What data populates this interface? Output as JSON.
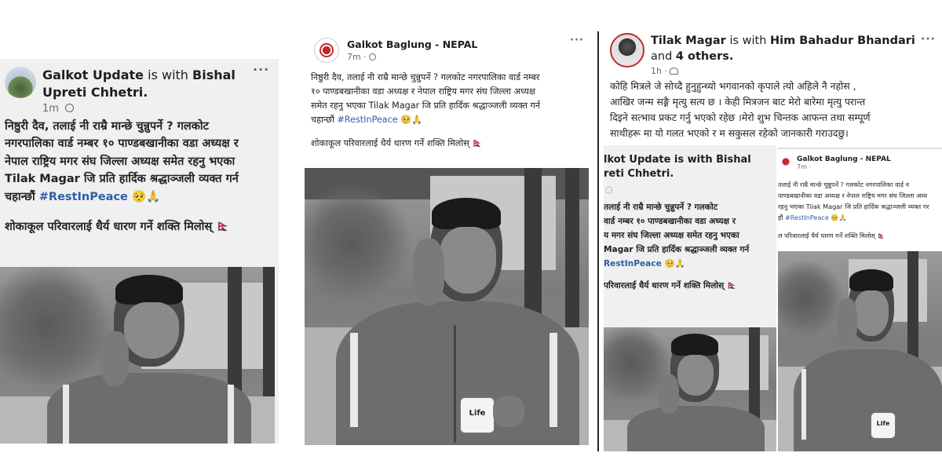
{
  "post1": {
    "page_name": "Galkot Update",
    "with_text": " is with ",
    "tagged": "Bishal Upreti Chhetri.",
    "time": "1m",
    "more": "···",
    "line1": "निष्ठुरी दैव, तलाई नी राम्रै मान्छे चुन्नुपर्ने ? गलकोट",
    "line2": "नगरपालिका वार्ड नम्बर १० पाण्डबखानीका वडा अध्यक्ष र",
    "line3": "नेपाल राष्ट्रिय मगर संघ जिल्ला अध्यक्ष समेत रहनु भएका",
    "line4": "Tilak Magar जि प्रति हार्दिक श्रद्धाञ्जली व्यक्त गर्न",
    "line5a": "चहान्छौं ",
    "hashtag": "#RestInPeace",
    "emoji": " 🥺🙏",
    "line6": "शोकाकूल परिवारलाई धैर्य धारण गर्ने शक्ति मिलोस् 🇳🇵"
  },
  "post2": {
    "page_name": "Galkot Baglung - NEPAL",
    "time": "7m · ",
    "globe": "🌐",
    "more": "···",
    "line1": "निष्ठुरी दैव, तलाई नी राम्रै मान्छे चुन्नुपर्ने ? गलकोट नगरपालिका वार्ड नम्बर",
    "line2": "१० पाण्डबखानीका वडा अध्यक्ष र नेपाल राष्ट्रिय मगर संघ जिल्ला अध्यक्ष",
    "line3": "समेत रहनु भएका Tilak Magar जि प्रति हार्दिक श्रद्धाञ्जली व्यक्त गर्न",
    "line4a": "चहान्छौं ",
    "hashtag": "#RestInPeace",
    "emoji": " 🥺🙏",
    "line5": "शोकाकूल परिवारलाई धैर्य धारण गर्ने शक्ति मिलोस् 🇳🇵",
    "mug_label": "Life"
  },
  "post3": {
    "author": "Tilak Magar",
    "with_text": " is with ",
    "tagged": "Him Bahadur Bhandari",
    "and_text": " and ",
    "others": "4 others.",
    "time": "1h · ",
    "more": "···",
    "line1": "कोहि मित्रले जे सोच्दै हुनुहुन्थ्यो भगवानको कृपाले त्यो अहिले नै नहोस ,",
    "line2": "आखिर जन्म सङ्गै मृत्यु सत्य छ । केही मित्रजन बाट  मेरो बारेमा मृत्यु परान्त",
    "line3": "दिइने सत्भाव प्रकट गर्नु भएको रहेछ ।मेरो शुभ चिन्तक आफन्त तथा सम्पूर्ण",
    "line4": "साथीहरू मा यो गलत भएको र म सकुसल रहेको जानकारी गराउदछु।",
    "embed_left": {
      "name1": "lkot Update is with Bishal",
      "name2": "reti Chhetri.",
      "line1": "तलाई नी राम्रै मान्छे चुन्नुपर्ने ? गलकोट",
      "line2": "वार्ड नम्बर १० पाण्डबखानीका वडा अध्यक्ष र",
      "line3": "य मगर संघ जिल्ला अध्यक्ष समेत रहनु भएका",
      "line4": "Magar जि प्रति हार्दिक श्रद्धाञ्जली व्यक्त गर्न",
      "hashtag": "RestInPeace",
      "emoji": " 🥺🙏",
      "line6": "परिवारलाई धैर्य धारण गर्ने शक्ति मिलोस् 🇳🇵"
    },
    "embed_right": {
      "page_name": "Galkot Baglung - NEPAL",
      "time": "7m · ",
      "line1": "तलाई नी राम्रै मान्छे चुन्नुपर्ने ? गलकोट नगरपालिका वार्ड न",
      "line2": "पाण्डबखानीका वडा अध्यक्ष र नेपाल राष्ट्रिय मगर संघ जिल्ला अध्य",
      "line3": "रहनु भएका Tilak Magar जि प्रति हार्दिक श्रद्धाञ्जली व्यक्त गर",
      "line4a": "हौं ",
      "hashtag": "#RestInPeace",
      "emoji": " 🥺🙏",
      "line5": "ल परिवारलाई धैर्य धारण गर्ने शक्ति मिलोस् 🇳🇵",
      "mug_label": "Life"
    }
  }
}
